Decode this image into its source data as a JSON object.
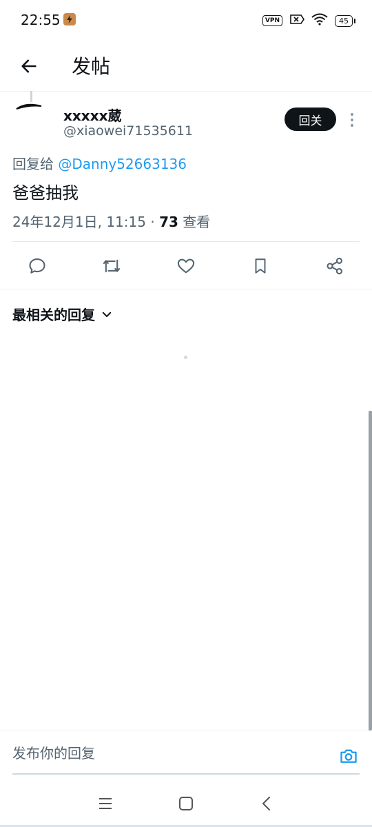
{
  "status_bar": {
    "time": "22:55",
    "app_icon": "flash-app-icon",
    "vpn_label": "VPN",
    "battery_level": "45",
    "icons": [
      "vpn-icon",
      "no-sim-icon",
      "wifi-icon",
      "battery-icon"
    ]
  },
  "header": {
    "title": "发帖",
    "back_icon": "arrow-left-icon"
  },
  "post": {
    "author_name": "xxxxx葳",
    "author_handle": "@xiaowei71535611",
    "follow_label": "回关",
    "reply_to_prefix": "回复给",
    "reply_to_mention": "@Danny52663136",
    "text": "爸爸抽我",
    "timestamp": "24年12月1日, 11:15",
    "separator": "·",
    "views_count": "73",
    "views_label": "查看"
  },
  "actions": [
    {
      "icon": "reply-icon"
    },
    {
      "icon": "retweet-icon"
    },
    {
      "icon": "like-icon"
    },
    {
      "icon": "bookmark-icon"
    },
    {
      "icon": "share-icon"
    }
  ],
  "replies": {
    "sort_label": "最相关的回复"
  },
  "composer": {
    "placeholder": "发布你的回复",
    "value": "",
    "camera_icon": "camera-icon"
  },
  "nav_bar": {
    "icons": [
      "menu-icon",
      "home-icon",
      "back-icon"
    ]
  },
  "colors": {
    "accent": "#1d9bf0",
    "text_primary": "#0f1419",
    "text_secondary": "#536471",
    "follow_button_bg": "#0f1419"
  }
}
